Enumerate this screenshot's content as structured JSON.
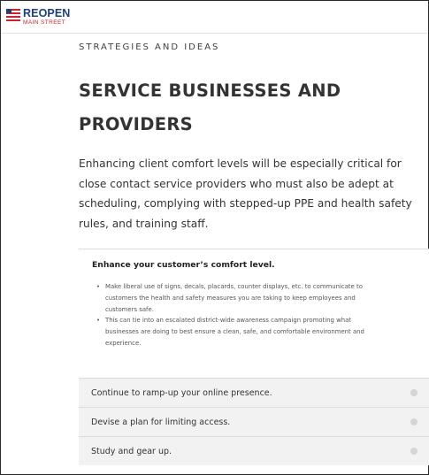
{
  "header": {
    "logo_main": "REOPEN",
    "logo_sub": "MAIN STREET",
    "colors": {
      "navy": "#1f3f7a",
      "red": "#c8232c"
    }
  },
  "page": {
    "eyebrow": "STRATEGIES AND IDEAS",
    "title_line1": "SERVICE BUSINESSES AND",
    "title_line2": "PROVIDERS",
    "intro_line1": "Enhancing client comfort levels will be especially critical for",
    "intro_line2": "close contact service providers who must also be adept at",
    "intro_line3": "scheduling, complying with stepped-up PPE and health safety",
    "intro_line4": "rules, and training staff."
  },
  "accordion": {
    "open": {
      "title": "Enhance your customer’s comfort level.",
      "bullets": [
        {
          "l1": "Make liberal use of signs, decals, placards, counter displays, etc. to communicate to",
          "l2": "customers the health and safety measures you are taking to keep employees and",
          "l3": "customers safe."
        },
        {
          "l1": "This can tie into an escalated district-wide awareness campaign promoting what",
          "l2": "businesses are doing to best ensure a clean, safe, and comfortable environment and",
          "l3": "experience."
        }
      ]
    },
    "items": [
      {
        "label": "Continue to ramp-up your online presence."
      },
      {
        "label": "Devise a plan for limiting access."
      },
      {
        "label": "Study and gear up."
      }
    ]
  }
}
